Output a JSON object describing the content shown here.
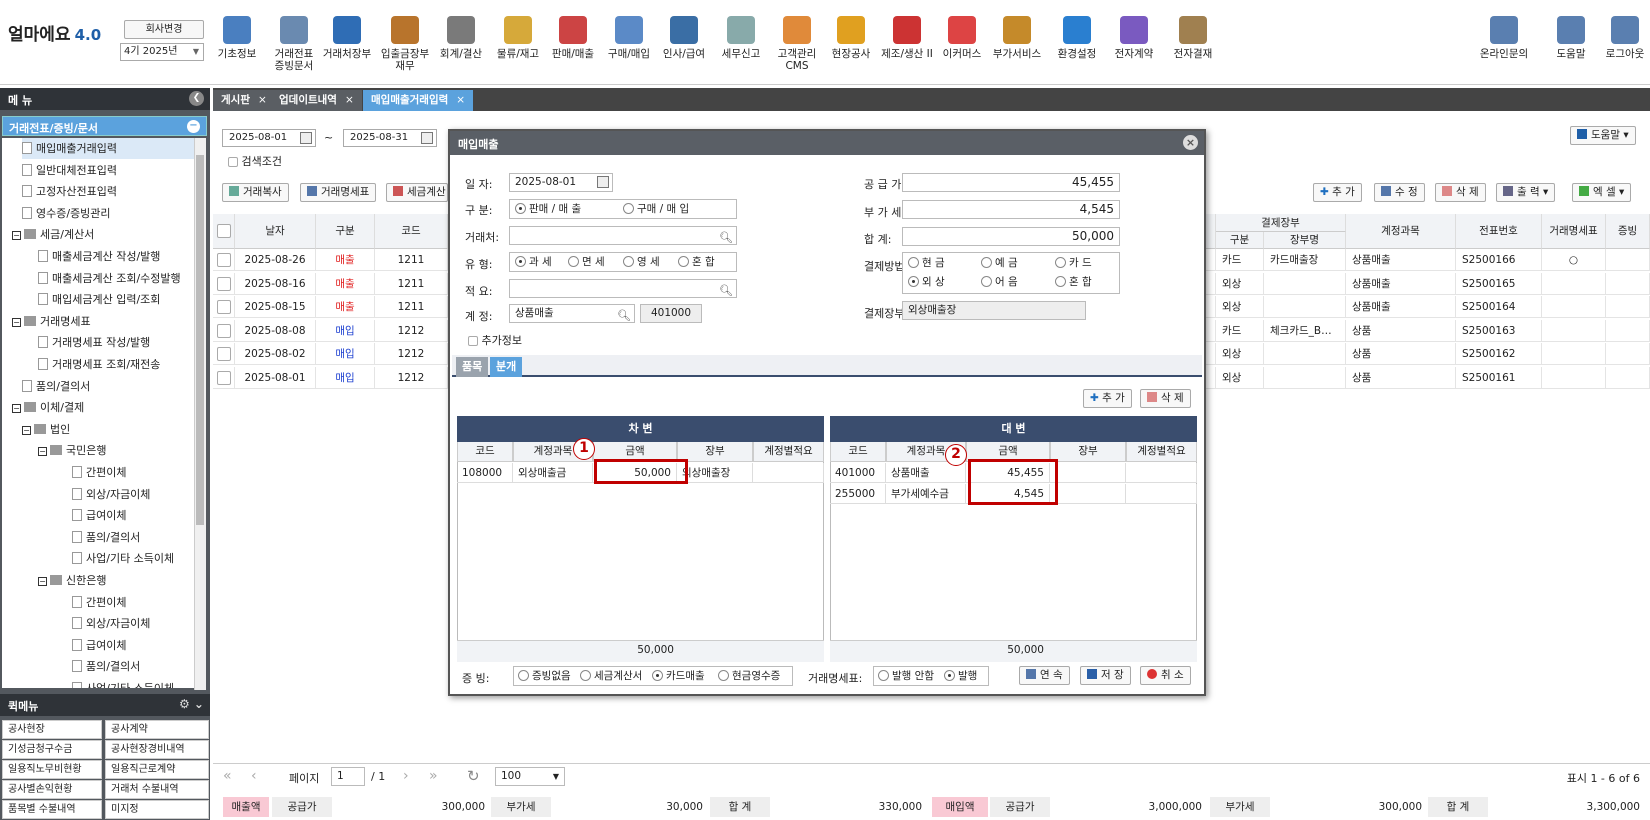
{
  "app": {
    "name": "얼마에요",
    "version": "4.0",
    "company_button": "회사변경",
    "period": "4기 2025년"
  },
  "top_menu": [
    {
      "label": "기초정보",
      "icon": "basic-info-icon"
    },
    {
      "label": "거래전표\n증빙문서",
      "icon": "voucher-icon"
    },
    {
      "label": "거래처장부",
      "icon": "ledger-icon"
    },
    {
      "label": "입출금장부\n재무",
      "icon": "money-bag-icon"
    },
    {
      "label": "회계/결산",
      "icon": "accounting-icon"
    },
    {
      "label": "물류/재고",
      "icon": "logistics-icon"
    },
    {
      "label": "판매/매출",
      "icon": "sales-icon"
    },
    {
      "label": "구매/매입",
      "icon": "purchase-icon"
    },
    {
      "label": "인사/급여",
      "icon": "hr-icon"
    },
    {
      "label": "세무신고",
      "icon": "tax-icon"
    },
    {
      "label": "고객관리\nCMS",
      "icon": "customer-icon"
    },
    {
      "label": "현장공사",
      "icon": "construction-icon"
    },
    {
      "label": "제조/생산 II",
      "icon": "factory-icon"
    },
    {
      "label": "이커머스",
      "icon": "shop-icon"
    },
    {
      "label": "부가서비스",
      "icon": "bank-icon"
    },
    {
      "label": "환경설정",
      "icon": "gear-icon"
    },
    {
      "label": "전자계약",
      "icon": "signature-icon"
    },
    {
      "label": "전자결재",
      "icon": "approval-icon"
    }
  ],
  "top_right": [
    {
      "label": "온라인문의",
      "icon": "support-icon"
    },
    {
      "label": "도움말",
      "icon": "help-book-icon"
    },
    {
      "label": "로그아웃",
      "icon": "logout-icon"
    }
  ],
  "sidebar": {
    "title": "메 뉴",
    "selected": "거래전표/증빙/문서",
    "tree": [
      "매입매출거래입력",
      "일반대체전표입력",
      "고정자산전표입력",
      "영수증/증빙관리",
      "세금/계산서",
      "매출세금계산 작성/발행",
      "매출세금계산 조회/수정발행",
      "매입세금계산 입력/조회",
      "거래명세표",
      "거래명세표 작성/발행",
      "거래명세표 조회/재전송",
      "품의/결의서",
      "이체/결제",
      "법인",
      "국민은행",
      "간편이체",
      "외상/자금이체",
      "급여이체",
      "품의/결의서",
      "사업/기타 소득이체",
      "신한은행",
      "간편이체",
      "외상/자금이체",
      "급여이체",
      "품의/결의서",
      "사업/기타 소득이체"
    ],
    "quick_title": "퀵메뉴",
    "quick": [
      "공사현장",
      "공사계약",
      "기성금청구수금",
      "공사현장경비내역",
      "일용직노무비현황",
      "일용직근로계약",
      "공사별손익현황",
      "거래처 수불내역",
      "품목별 수불내역",
      "미지정"
    ]
  },
  "tabs": [
    "게시판",
    "업데이트내역",
    "매입매출거래입력"
  ],
  "filter": {
    "date_from": "2025-08-01",
    "date_to": "2025-08-31",
    "tilde": "~",
    "search_cond": "검색조건",
    "help": "도움말"
  },
  "toolbar": {
    "copy": "거래복사",
    "statement": "거래명세표",
    "tax": "세금계산",
    "add": "추 가",
    "edit": "수 정",
    "delete": "삭 제",
    "print": "출 력",
    "excel": "엑 셀"
  },
  "grid": {
    "headers": [
      "날자",
      "구분",
      "코드"
    ],
    "right_headers": {
      "pay_group": "결제장부",
      "pay_type": "구분",
      "pay_book": "장부명",
      "account": "계정과목",
      "voucher": "전표번호",
      "statement": "거래명세표",
      "proof": "증빙"
    },
    "rows": [
      {
        "date": "2025-08-26",
        "type": "매출",
        "code": "1211",
        "pay": "카드",
        "book": "카드매출장",
        "account": "상품매출",
        "voucher": "S2500166",
        "stmt": "○"
      },
      {
        "date": "2025-08-16",
        "type": "매출",
        "code": "1211",
        "pay": "외상",
        "book": "",
        "account": "상품매출",
        "voucher": "S2500165",
        "stmt": ""
      },
      {
        "date": "2025-08-15",
        "type": "매출",
        "code": "1211",
        "pay": "외상",
        "book": "",
        "account": "상품매출",
        "voucher": "S2500164",
        "stmt": ""
      },
      {
        "date": "2025-08-08",
        "type": "매입",
        "code": "1212",
        "pay": "카드",
        "book": "체크카드_B…",
        "account": "상품",
        "voucher": "S2500163",
        "stmt": ""
      },
      {
        "date": "2025-08-02",
        "type": "매입",
        "code": "1212",
        "pay": "외상",
        "book": "",
        "account": "상품",
        "voucher": "S2500162",
        "stmt": ""
      },
      {
        "date": "2025-08-01",
        "type": "매입",
        "code": "1212",
        "pay": "외상",
        "book": "",
        "account": "상품",
        "voucher": "S2500161",
        "stmt": ""
      }
    ]
  },
  "pager": {
    "page_label": "페이지",
    "page": "1",
    "total": "/ 1",
    "size": "100",
    "info": "표시 1 - 6 of 6"
  },
  "summary": {
    "sales": "매출액",
    "supply": "공급가",
    "supply_val": "300,000",
    "vat": "부가세",
    "vat_val": "30,000",
    "total": "합 계",
    "total_val": "330,000",
    "purchase": "매입액",
    "p_supply": "공급가",
    "p_supply_val": "3,000,000",
    "p_vat": "부가세",
    "p_vat_val": "300,000",
    "p_total": "합 계",
    "p_total_val": "3,300,000"
  },
  "dialog": {
    "title": "매입매출",
    "date_label": "일    자:",
    "date": "2025-08-01",
    "kind_label": "구    분:",
    "kind_sale": "판매 / 매 출",
    "kind_buy": "구매 / 매 입",
    "vendor_label": "거래처:",
    "vendor": "",
    "taxtype_label": "유    형:",
    "tax1": "과 세",
    "tax2": "면 세",
    "tax3": "영 세",
    "tax4": "혼 합",
    "memo_label": "적    요:",
    "memo": "",
    "account_label": "계    정:",
    "account": "상품매출",
    "account_code": "401000",
    "supply_label": "공 급 가:",
    "supply": "45,455",
    "vat_label": "부 가 세:",
    "vat": "4,545",
    "total_label": "합    계:",
    "total": "50,000",
    "pay_label": "결제방법:",
    "pay_opts": [
      "현 금",
      "예 금",
      "카 드",
      "외 상",
      "어 음",
      "혼 합"
    ],
    "paybook_label": "결제장부:",
    "paybook": "외상매출장",
    "extra": "추가정보",
    "subtabs": [
      "품목",
      "분개"
    ],
    "add": "추 가",
    "del": "삭 제",
    "debit": {
      "title": "차 변",
      "headers": [
        "코드",
        "계정과목",
        "금액",
        "장부",
        "계정별적요"
      ],
      "rows": [
        {
          "code": "108000",
          "acct": "외상매출금",
          "amt": "50,000",
          "book": "외상매출장",
          "memo": ""
        }
      ],
      "sum": "50,000"
    },
    "credit": {
      "title": "대 변",
      "headers": [
        "코드",
        "계정과목",
        "금액",
        "장부",
        "계정별적요"
      ],
      "rows": [
        {
          "code": "401000",
          "acct": "상품매출",
          "amt": "45,455",
          "book": "",
          "memo": ""
        },
        {
          "code": "255000",
          "acct": "부가세예수금",
          "amt": "4,545",
          "book": "",
          "memo": ""
        }
      ],
      "sum": "50,000"
    },
    "proof_label": "증 빙:",
    "proofs": [
      "증빙없음",
      "세금계산서",
      "카드매출",
      "현금영수증"
    ],
    "stmt_label": "거래명세표:",
    "stmt_opts": [
      "발행 안함",
      "발행"
    ],
    "btn_next": "연 속",
    "btn_save": "저 장",
    "btn_cancel": "취 소",
    "marker1": "1",
    "marker2": "2"
  }
}
